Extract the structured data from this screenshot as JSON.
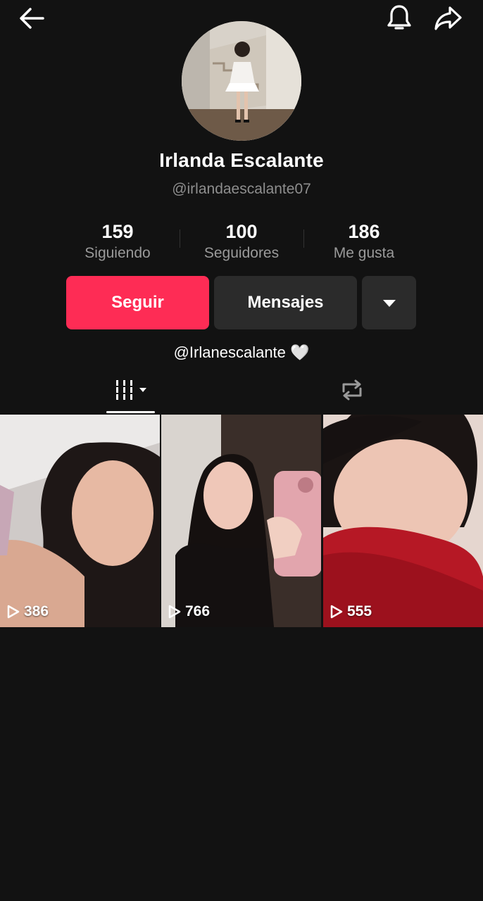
{
  "header": {
    "back_icon": "arrow-left-icon",
    "bell_icon": "bell-icon",
    "share_icon": "share-arrow-icon"
  },
  "profile": {
    "name": "Irlanda Escalante",
    "handle": "@irlandaescalante07",
    "bio": "@Irlanescalante 🤍"
  },
  "stats": [
    {
      "value": "159",
      "label": "Siguiendo"
    },
    {
      "value": "100",
      "label": "Seguidores"
    },
    {
      "value": "186",
      "label": "Me gusta"
    }
  ],
  "actions": {
    "follow_label": "Seguir",
    "message_label": "Mensajes",
    "more_icon": "caret-down-icon"
  },
  "tabs": [
    {
      "icon": "videos-grid-icon",
      "active": true
    },
    {
      "icon": "repost-icon",
      "active": false
    }
  ],
  "videos": [
    {
      "views": "386"
    },
    {
      "views": "766"
    },
    {
      "views": "555"
    }
  ],
  "colors": {
    "background": "#121212",
    "accent": "#fe2c55",
    "secondary_button": "#2b2b2b",
    "muted_text": "#8e8e8e"
  }
}
